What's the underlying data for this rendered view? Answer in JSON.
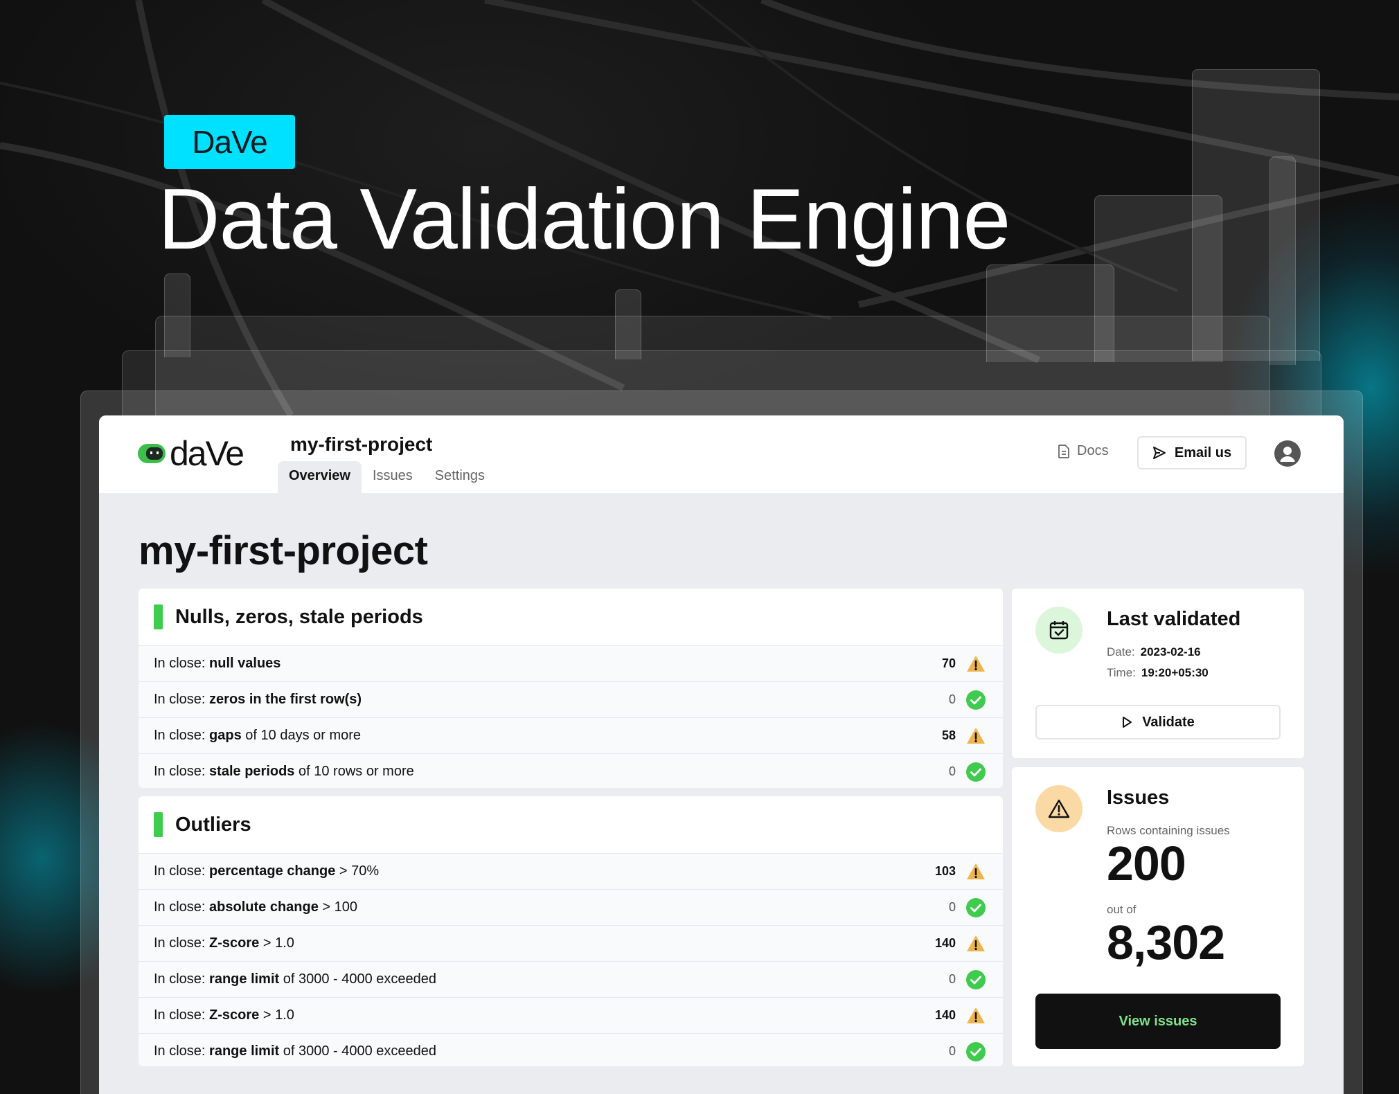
{
  "hero": {
    "tag": "DaVe",
    "title": "Data Validation Engine"
  },
  "app": {
    "logo_text": "daVe",
    "project_title": "my-first-project",
    "tabs": [
      {
        "label": "Overview",
        "active": true
      },
      {
        "label": "Issues",
        "active": false
      },
      {
        "label": "Settings",
        "active": false
      }
    ],
    "docs_label": "Docs",
    "email_label": "Email us"
  },
  "page_title": "my-first-project",
  "sections": [
    {
      "title": "Nulls, zeros, stale periods",
      "rows": [
        {
          "prefix": "In close: ",
          "bold": "null values",
          "suffix": "",
          "count": "70",
          "status": "warning"
        },
        {
          "prefix": "In close: ",
          "bold": "zeros in the first row(s)",
          "suffix": "",
          "count": "0",
          "status": "ok"
        },
        {
          "prefix": "In close: ",
          "bold": "gaps",
          "suffix": " of 10 days or more",
          "count": "58",
          "status": "warning"
        },
        {
          "prefix": "In close: ",
          "bold": "stale periods",
          "suffix": " of 10 rows or more",
          "count": "0",
          "status": "ok"
        }
      ]
    },
    {
      "title": "Outliers",
      "rows": [
        {
          "prefix": "In close: ",
          "bold": "percentage change",
          "suffix": " > 70%",
          "count": "103",
          "status": "warning"
        },
        {
          "prefix": "In close: ",
          "bold": "absolute change",
          "suffix": " > 100",
          "count": "0",
          "status": "ok"
        },
        {
          "prefix": "In close: ",
          "bold": "Z-score",
          "suffix": " > 1.0",
          "count": "140",
          "status": "warning"
        },
        {
          "prefix": "In close: ",
          "bold": "range limit",
          "suffix": " of 3000 - 4000 exceeded",
          "count": "0",
          "status": "ok"
        },
        {
          "prefix": "In close: ",
          "bold": "Z-score",
          "suffix": " > 1.0",
          "count": "140",
          "status": "warning"
        },
        {
          "prefix": "In close: ",
          "bold": "range limit",
          "suffix": " of 3000 - 4000 exceeded",
          "count": "0",
          "status": "ok"
        }
      ]
    }
  ],
  "last_validated": {
    "title": "Last validated",
    "date_label": "Date:",
    "date": "2023-02-16",
    "time_label": "Time:",
    "time": "19:20+05:30",
    "validate_label": "Validate"
  },
  "issues": {
    "title": "Issues",
    "rows_label": "Rows containing issues",
    "rows_value": "200",
    "out_of_label": "out of",
    "total_value": "8,302",
    "view_label": "View issues"
  },
  "colors": {
    "accent": "#00e0ff",
    "ok": "#3ecb4e",
    "warning": "#f0b44c",
    "dark": "#111111"
  },
  "icons": {
    "docs": "document-icon",
    "email": "send-icon",
    "avatar": "user-icon",
    "calendar": "calendar-check-icon",
    "issues": "alert-triangle-icon"
  }
}
